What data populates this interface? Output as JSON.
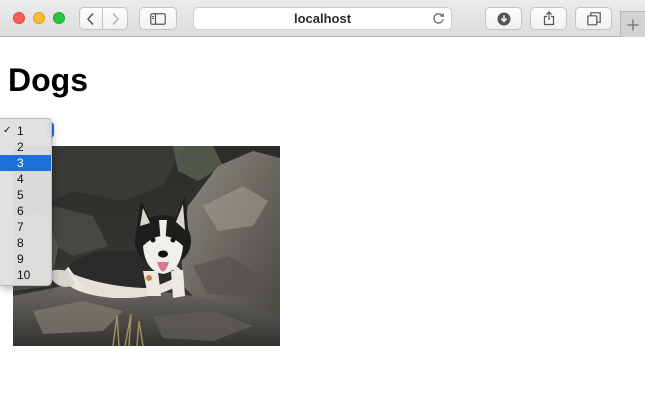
{
  "browser": {
    "address": "localhost",
    "icons": {
      "back": "chevron-left-icon",
      "forward": "chevron-right-icon",
      "sidebar": "sidebar-icon",
      "reload": "reload-icon",
      "download": "download-icon",
      "share": "share-icon",
      "tabs": "tabs-overview-icon",
      "new_tab": "plus-icon"
    },
    "traffic_light_colors": [
      "#fc5f57",
      "#fdbc2e",
      "#28c840"
    ]
  },
  "page": {
    "title": "Dogs",
    "select": {
      "selected_value": "1",
      "highlighted_value": "3",
      "options": [
        "1",
        "2",
        "3",
        "4",
        "5",
        "6",
        "7",
        "8",
        "9",
        "10"
      ],
      "checkmark": "✓",
      "accent_color": "#1e6fd9"
    },
    "image": {
      "subject": "husky-dog-photo"
    }
  }
}
